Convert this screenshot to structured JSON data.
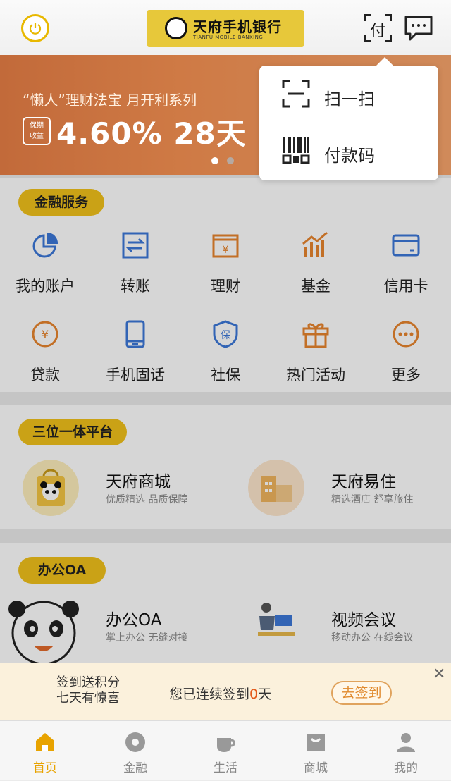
{
  "header": {
    "logo_title": "天府手机银行",
    "logo_sub": "TIANFU MOBILE BANKING",
    "pay_label": "付"
  },
  "banner": {
    "subtitle": "“懒人”理财法宝 月开利系列",
    "tag": "保期\n收益",
    "rate": "4.60% 28天",
    "active_dot": 0
  },
  "popup": {
    "items": [
      {
        "label": "扫一扫",
        "icon": "scan-icon"
      },
      {
        "label": "付款码",
        "icon": "barcode-icon"
      }
    ]
  },
  "finance": {
    "title": "金融服务",
    "items": [
      {
        "label": "我的账户",
        "icon": "pie-chart-icon"
      },
      {
        "label": "转账",
        "icon": "transfer-icon"
      },
      {
        "label": "理财",
        "icon": "wealth-icon"
      },
      {
        "label": "基金",
        "icon": "fund-chart-icon"
      },
      {
        "label": "信用卡",
        "icon": "credit-card-icon"
      },
      {
        "label": "贷款",
        "icon": "loan-icon"
      },
      {
        "label": "手机固话",
        "icon": "phone-icon"
      },
      {
        "label": "社保",
        "icon": "shield-icon"
      },
      {
        "label": "热门活动",
        "icon": "gift-icon"
      },
      {
        "label": "更多",
        "icon": "more-icon"
      }
    ]
  },
  "platform": {
    "title": "三位一体平台",
    "tiles": [
      {
        "name": "天府商城",
        "desc": "优质精选 品质保障",
        "icon": "panda-bag-icon"
      },
      {
        "name": "天府易住",
        "desc": "精选酒店 舒享旅住",
        "icon": "hotel-icon"
      }
    ]
  },
  "office": {
    "title": "办公OA",
    "tiles": [
      {
        "name": "办公OA",
        "desc": "掌上办公 无缝对接",
        "icon": "panda-mascot-icon"
      },
      {
        "name": "视频会议",
        "desc": "移动办公 在线会议",
        "icon": "meeting-icon"
      }
    ]
  },
  "signin": {
    "line1": "签到送积分",
    "line2": "七天有惊喜",
    "status_prefix": "您已连续签到",
    "days": "0",
    "status_suffix": "天",
    "button": "去签到"
  },
  "nav": {
    "items": [
      {
        "label": "首页",
        "icon": "home-icon"
      },
      {
        "label": "金融",
        "icon": "finance-icon"
      },
      {
        "label": "生活",
        "icon": "life-icon"
      },
      {
        "label": "商城",
        "icon": "mall-icon"
      },
      {
        "label": "我的",
        "icon": "profile-icon"
      }
    ],
    "active": 0
  },
  "colors": {
    "accent": "#f1c21b",
    "banner": "#cf7a45",
    "icon_blue": "#3c78d8",
    "icon_orange": "#e8852e"
  }
}
